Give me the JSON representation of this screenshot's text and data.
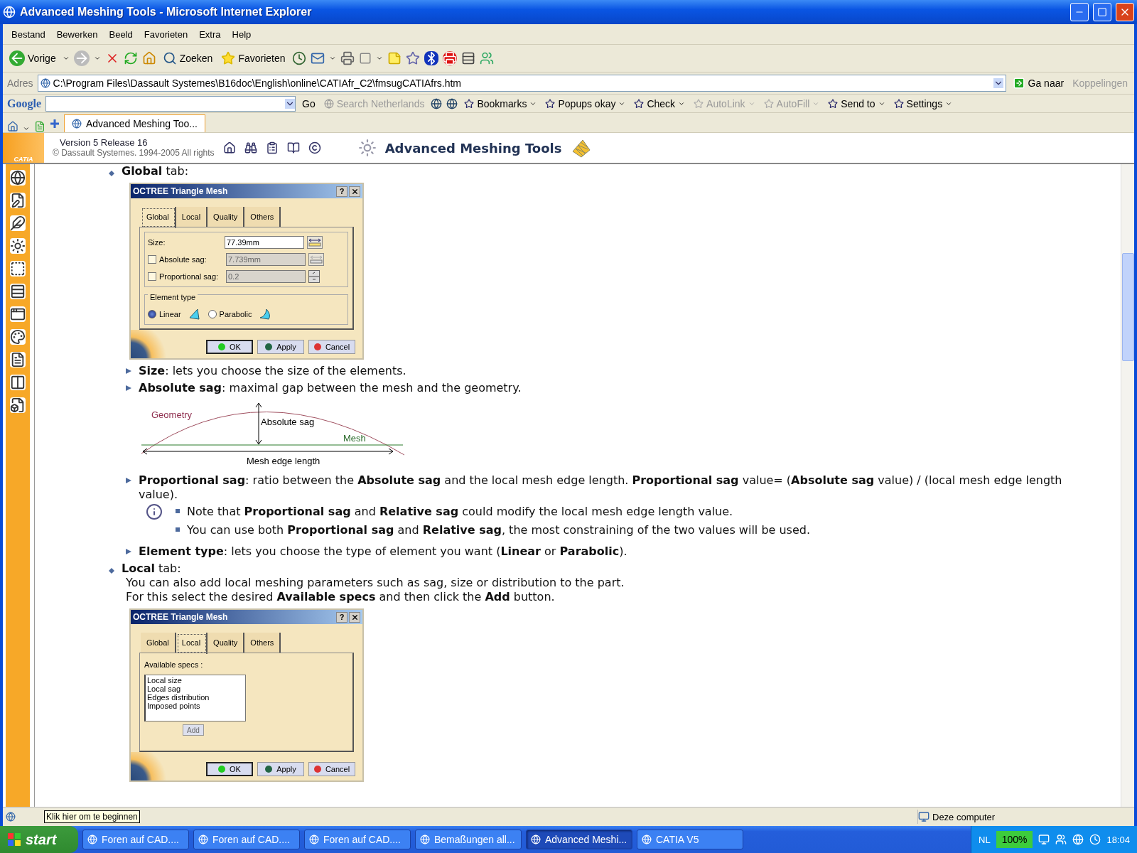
{
  "window": {
    "title": "Advanced Meshing Tools - Microsoft Internet Explorer"
  },
  "menu": [
    "Bestand",
    "Bewerken",
    "Beeld",
    "Favorieten",
    "Extra",
    "Help"
  ],
  "toolbar": {
    "back": "Vorige",
    "search": "Zoeken",
    "favorites": "Favorieten"
  },
  "address": {
    "label": "Adres",
    "value": "C:\\Program Files\\Dassault Systemes\\B16doc\\English\\online\\CATIAfr_C2\\fmsugCATIAfrs.htm",
    "go": "Ga naar",
    "links": "Koppelingen"
  },
  "google_bar": {
    "logo": "Google",
    "go": "Go",
    "search": "Search Netherlands",
    "items": [
      {
        "label": "Bookmarks",
        "disabled": false
      },
      {
        "label": "Popups okay",
        "disabled": false
      },
      {
        "label": "Check",
        "disabled": false
      },
      {
        "label": "AutoLink",
        "disabled": true
      },
      {
        "label": "AutoFill",
        "disabled": true
      },
      {
        "label": "Send to",
        "disabled": false
      },
      {
        "label": "Settings",
        "disabled": false
      }
    ]
  },
  "tab": {
    "label": "Advanced Meshing Too..."
  },
  "doc_header": {
    "logo": "CATIA",
    "version": "Version 5 Release 16",
    "copyright": "© Dassault Systemes. 1994-2005 All rights",
    "title": "Advanced Meshing Tools"
  },
  "global_section": {
    "heading": "**Global** tab:",
    "dialog": {
      "title": "OCTREE Triangle Mesh",
      "help": "?",
      "tabs": [
        {
          "label": "Global",
          "selected": true
        },
        {
          "label": "Local",
          "selected": false
        },
        {
          "label": "Quality",
          "selected": false
        },
        {
          "label": "Others",
          "selected": false
        }
      ],
      "size": {
        "label": "Size:",
        "value": "77.39mm"
      },
      "absolute_sag": {
        "label": "Absolute sag:",
        "checked": false,
        "value": "7.739mm",
        "disabled": true
      },
      "proportional_sag": {
        "label": "Proportional sag:",
        "checked": false,
        "value": "0.2",
        "disabled": true
      },
      "element_type": {
        "legend": "Element type",
        "options": [
          {
            "label": "Linear",
            "selected": true
          },
          {
            "label": "Parabolic",
            "selected": false
          }
        ]
      },
      "buttons": [
        "OK",
        "Apply",
        "Cancel"
      ]
    },
    "bullets_top": [
      "**Size**: lets you choose the size of the elements.",
      "**Absolute sag**: maximal gap between the mesh and the geometry."
    ],
    "diagram": {
      "geometry": "Geometry",
      "absolute_sag": "Absolute sag",
      "mesh": "Mesh",
      "edge_length": "Mesh edge length"
    },
    "bullet_prop": "**Proportional sag**: ratio between the **Absolute sag** and the local mesh edge length. **Proportional sag** value= (**Absolute sag** value) / (local mesh edge length value).",
    "notes": [
      "Note that **Proportional sag** and **Relative sag** could modify the local mesh edge length value.",
      "You can use both **Proportional sag** and **Relative sag**, the most constraining of the two values will be used."
    ],
    "bullet_element": "**Element type**: lets you choose the type of element you want (**Linear** or **Parabolic**)."
  },
  "local_section": {
    "heading": "**Local** tab:",
    "paragraphs": [
      "You can also add local meshing parameters such as sag, size or distribution to the part.",
      "For this select the desired **Available specs** and then click the **Add** button."
    ],
    "dialog": {
      "title": "OCTREE Triangle Mesh",
      "help": "?",
      "tabs": [
        {
          "label": "Global",
          "selected": false
        },
        {
          "label": "Local",
          "selected": true
        },
        {
          "label": "Quality",
          "selected": false
        },
        {
          "label": "Others",
          "selected": false
        }
      ],
      "list_label": "Available specs :",
      "specs": [
        "Local size",
        "Local sag",
        "Edges distribution",
        "Imposed points"
      ],
      "add": {
        "label": "Add",
        "disabled": true
      },
      "buttons": [
        "OK",
        "Apply",
        "Cancel"
      ]
    }
  },
  "status_bar": {
    "zone": "Deze computer",
    "tooltip": "Klik hier om te beginnen"
  },
  "taskbar": {
    "start": "start",
    "tasks": [
      {
        "label": "Foren auf CAD....",
        "selected": false
      },
      {
        "label": "Foren auf CAD....",
        "selected": false
      },
      {
        "label": "Foren auf CAD....",
        "selected": false
      },
      {
        "label": "Bemaßungen all...",
        "selected": false
      },
      {
        "label": "Advanced Meshi...",
        "selected": true
      },
      {
        "label": "CATIA V5",
        "selected": false
      }
    ],
    "language": "NL",
    "battery": "100%",
    "clock": "18:04"
  }
}
